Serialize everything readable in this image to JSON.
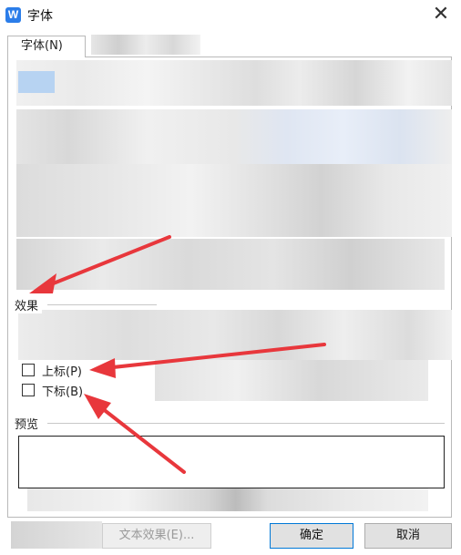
{
  "window": {
    "title": "字体",
    "app_icon_glyph": "W",
    "close_glyph": "✕"
  },
  "tabs": [
    {
      "label": "字体(N)"
    }
  ],
  "effects": {
    "label": "效果",
    "superscript_label": "上标(P)",
    "subscript_label": "下标(B)"
  },
  "preview": {
    "label": "预览"
  },
  "buttons": {
    "text_effect": "文本效果(E)...",
    "ok": "确定",
    "cancel": "取消"
  },
  "colors": {
    "accent": "#e8373c",
    "app_icon": "#2b7de9"
  }
}
